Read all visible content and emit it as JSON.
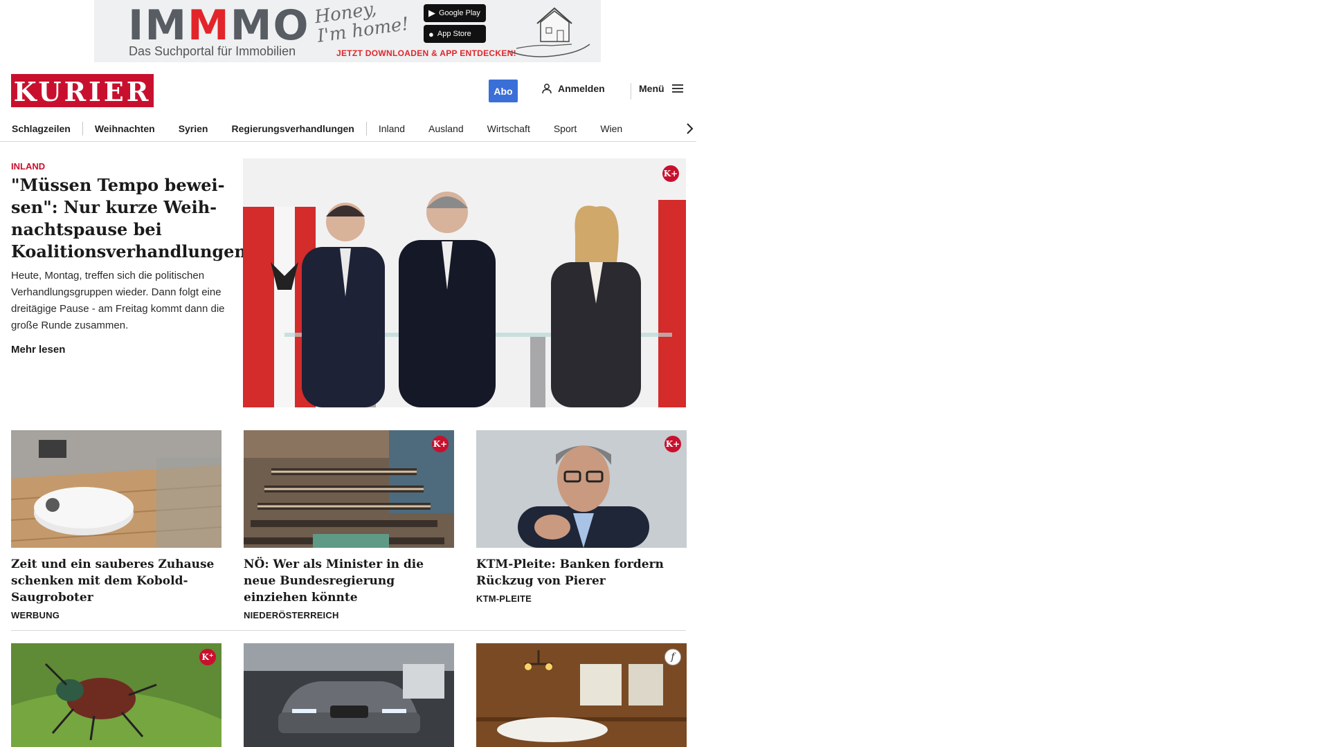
{
  "ad": {
    "logo_start": "IM",
    "logo_red": "M",
    "logo_end": "MO",
    "subtitle": "Das Suchportal für Immobilien",
    "script": "Honey,\nI'm home!",
    "google_play": "Google Play",
    "app_store": "App Store",
    "cta": "JETZT DOWNLOADEN & APP ENTDECKEN!"
  },
  "header": {
    "logo": "KURIER",
    "abo": "Abo",
    "login": "Anmelden",
    "menu": "Menü"
  },
  "nav": {
    "items": [
      "Schlagzeilen",
      "Weihnachten",
      "Syrien",
      "Regierungsverhandlungen",
      "Inland",
      "Ausland",
      "Wirtschaft",
      "Sport",
      "Wien"
    ]
  },
  "lead": {
    "kicker": "INLAND",
    "title": "\"Müssen Tempo bewei­sen\": Nur kurze Weih­nachtspause bei Koalitionsverhandlungen",
    "teaser": "Heute, Montag, treffen sich die politischen Verhandlungsgruppen wieder. Dann folgt eine dreitägige Pause - am Freitag kommt dann die große Runde zusammen.",
    "more": "Mehr lesen",
    "badge": "K+"
  },
  "cards": [
    {
      "title": "Zeit und ein sauberes Zuhause schenken mit dem Kobold-Saugroboter",
      "tag": "WERBUNG"
    },
    {
      "title": "NÖ: Wer als Minister in die neue Bundesregierung einziehen könnte",
      "tag": "NIEDERÖSTERREICH",
      "badge": "K+"
    },
    {
      "title": "KTM-Pleite: Banken fordern Rück­zug von Pierer",
      "tag": "KTM-PLEITE",
      "badge": "K+"
    }
  ],
  "colors": {
    "brand_red": "#c8102e",
    "abo_blue": "#3a6fd8"
  }
}
